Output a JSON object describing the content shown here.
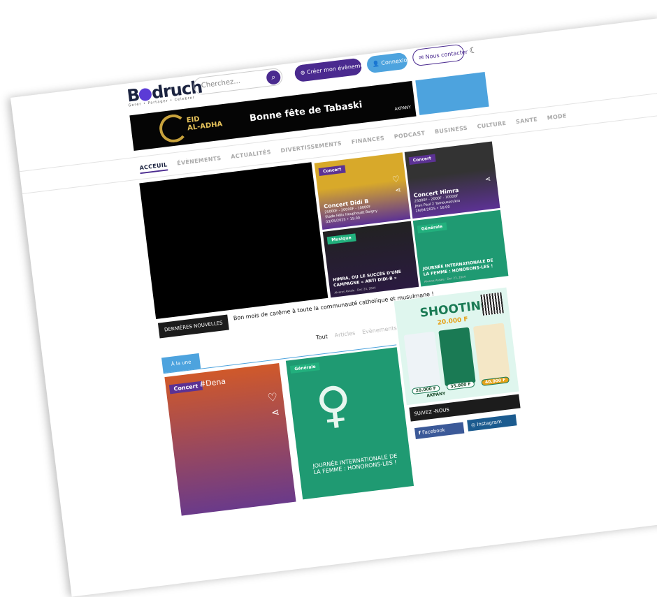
{
  "header": {
    "logo": "Bodruch",
    "logo_tagline": "Gerer • Partager • Celebrer",
    "search_placeholder": "Cherchez...",
    "create_label": "Créer mon évènement",
    "connexion_label": "Connexion",
    "contact_label": "Nous contacter"
  },
  "banner": {
    "eid": "EID",
    "adha": "AL-ADHA",
    "message": "Bonne fête de Tabaski",
    "brand": "AKPANY"
  },
  "nav": [
    "ACCEUIL",
    "ÉVÈNEMENTS",
    "ACTUALITÉS",
    "DIVERTISSEMENTS",
    "FINANCES",
    "PODCAST",
    "BUSINESS",
    "CULTURE",
    "SANTE",
    "MODE"
  ],
  "cards": [
    {
      "tag": "Concert",
      "title": "Concert Didi B",
      "price": "25000F - 20000F - 10000F",
      "place": "Stade Félix Houphouët Boigny",
      "date": "03/05/2025 • 15:00"
    },
    {
      "tag": "Concert",
      "title": "Concert Himra",
      "price": "25000F - 2000F - 10000F",
      "place": "Jean Paul 2 Yamoussoukro",
      "date": "26/04/2025 • 16:00"
    },
    {
      "tag": "Musique",
      "title": "HIMRA, OU LE SUCCÈS D'UNE CAMPAGNE « ANTI DIDI-B »",
      "author": "Alvares Assale · Dec 23, 2024"
    },
    {
      "tag": "Générale",
      "title": "JOURNÉE INTERNATIONALE DE LA FEMME : HONORONS-LES !",
      "author": "Alvares Assale · Dec 23, 2024"
    }
  ],
  "news": {
    "label": "DERNIÈRES NOUVELLES",
    "ticker": "Bon mois de carême à toute la communauté catholique et musulmane !"
  },
  "tabs": [
    "Tout",
    "Articles",
    "Evènements"
  ],
  "une_label": "À la une",
  "dena": {
    "tag": "Concert",
    "hash": "#Dena"
  },
  "green": {
    "tag": "Générale",
    "title": "JOURNÉE INTERNATIONALE DE LA FEMME : HONORONS-LES !"
  },
  "ad": {
    "title": "SHOOTING",
    "price": "20.000 F",
    "p1": "20.000 F",
    "p2": "35.000 F",
    "p3": "40.000 F",
    "brand": "AKPANY"
  },
  "social": {
    "title": "SUIVEZ -NOUS",
    "facebook": "Facebook",
    "instagram": "Instagram"
  }
}
